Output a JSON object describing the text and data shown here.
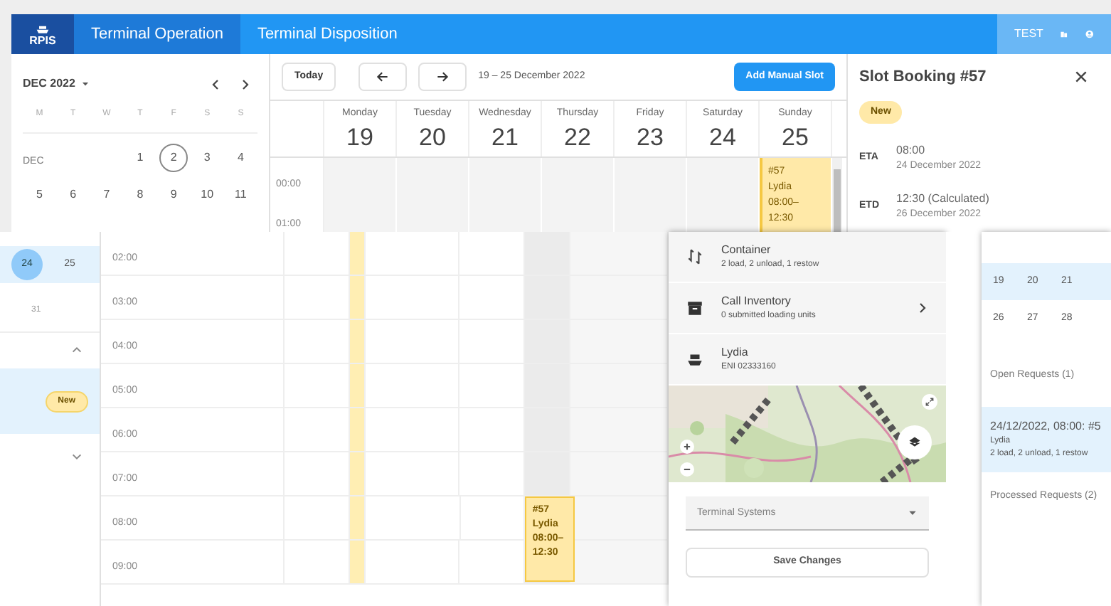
{
  "header": {
    "logo": "RPIS",
    "tabs": [
      {
        "label": "Terminal Operation",
        "selected": true
      },
      {
        "label": "Terminal Disposition",
        "selected": false
      }
    ],
    "user": "TEST"
  },
  "mini_calendar": {
    "month": "DEC 2022",
    "weekdays": [
      "M",
      "T",
      "W",
      "T",
      "F",
      "S",
      "S"
    ],
    "weeks": [
      {
        "label": "DEC",
        "days": [
          {
            "text": "1",
            "today": false
          },
          {
            "text": "2",
            "today": true
          },
          {
            "text": "3",
            "today": false
          },
          {
            "text": "4",
            "today": false
          }
        ]
      },
      {
        "days": [
          {
            "text": "5",
            "today": false
          },
          {
            "text": "6",
            "today": false
          },
          {
            "text": "7",
            "today": false
          },
          {
            "text": "8",
            "today": false
          },
          {
            "text": "9",
            "today": false
          },
          {
            "text": "10",
            "today": false
          },
          {
            "text": "11",
            "today": false
          }
        ]
      }
    ]
  },
  "calendar": {
    "today_button": "Today",
    "range": "19 – 25 December 2022",
    "add_button": "Add Manual Slot",
    "hours": [
      "00:00",
      "01:00"
    ],
    "days": [
      {
        "weekday": "Monday",
        "date": "19"
      },
      {
        "weekday": "Tuesday",
        "date": "20"
      },
      {
        "weekday": "Wednesday",
        "date": "21"
      },
      {
        "weekday": "Thursday",
        "date": "22"
      },
      {
        "weekday": "Friday",
        "date": "23"
      },
      {
        "weekday": "Saturday",
        "date": "24"
      },
      {
        "weekday": "Sunday",
        "date": "25",
        "events": [
          {
            "title": "#57",
            "vessel": "Lydia",
            "time": "08:00–12:30"
          }
        ]
      }
    ]
  },
  "booking": {
    "title": "Slot Booking #57",
    "status": "New",
    "times": [
      {
        "label": "ETA",
        "time": "08:00",
        "date": "24 December 2022"
      },
      {
        "label": "ETD",
        "time": "12:30 (Calculated)",
        "date": "26 December 2022"
      }
    ]
  },
  "left_strip": {
    "days": [
      {
        "text": "24",
        "selected": true
      },
      {
        "text": "25",
        "selected": false
      }
    ],
    "next_row": "31",
    "badge": "New"
  },
  "timeline": {
    "hours": [
      "02:00",
      "03:00",
      "04:00",
      "05:00",
      "06:00",
      "07:00",
      "08:00",
      "09:00"
    ],
    "event": {
      "title": "#57",
      "vessel": "Lydia",
      "time": "08:00–12:30"
    }
  },
  "details": {
    "rows": [
      {
        "kind": "container",
        "title": "Container",
        "subtitle": "2 load, 2 unload, 1 restow",
        "expandable": false
      },
      {
        "kind": "inventory",
        "title": "Call Inventory",
        "subtitle": "0 submitted loading units",
        "expandable": true
      },
      {
        "kind": "vessel",
        "title": "Lydia",
        "subtitle": "ENI 02333160",
        "expandable": false
      }
    ],
    "select": {
      "placeholder": "Terminal Systems"
    },
    "save_button": "Save Changes"
  },
  "requests": {
    "weeks": [
      {
        "selected": true,
        "days": [
          "19",
          "20",
          "21"
        ]
      },
      {
        "selected": false,
        "days": [
          "26",
          "27",
          "28"
        ]
      }
    ],
    "open_title": "Open Requests (1)",
    "open": [
      {
        "title": "24/12/2022, 08:00: #5",
        "vessel": "Lydia",
        "summary": "2 load, 2 unload, 1 restow",
        "selected": true
      }
    ],
    "processed_title": "Processed Requests (2)"
  }
}
